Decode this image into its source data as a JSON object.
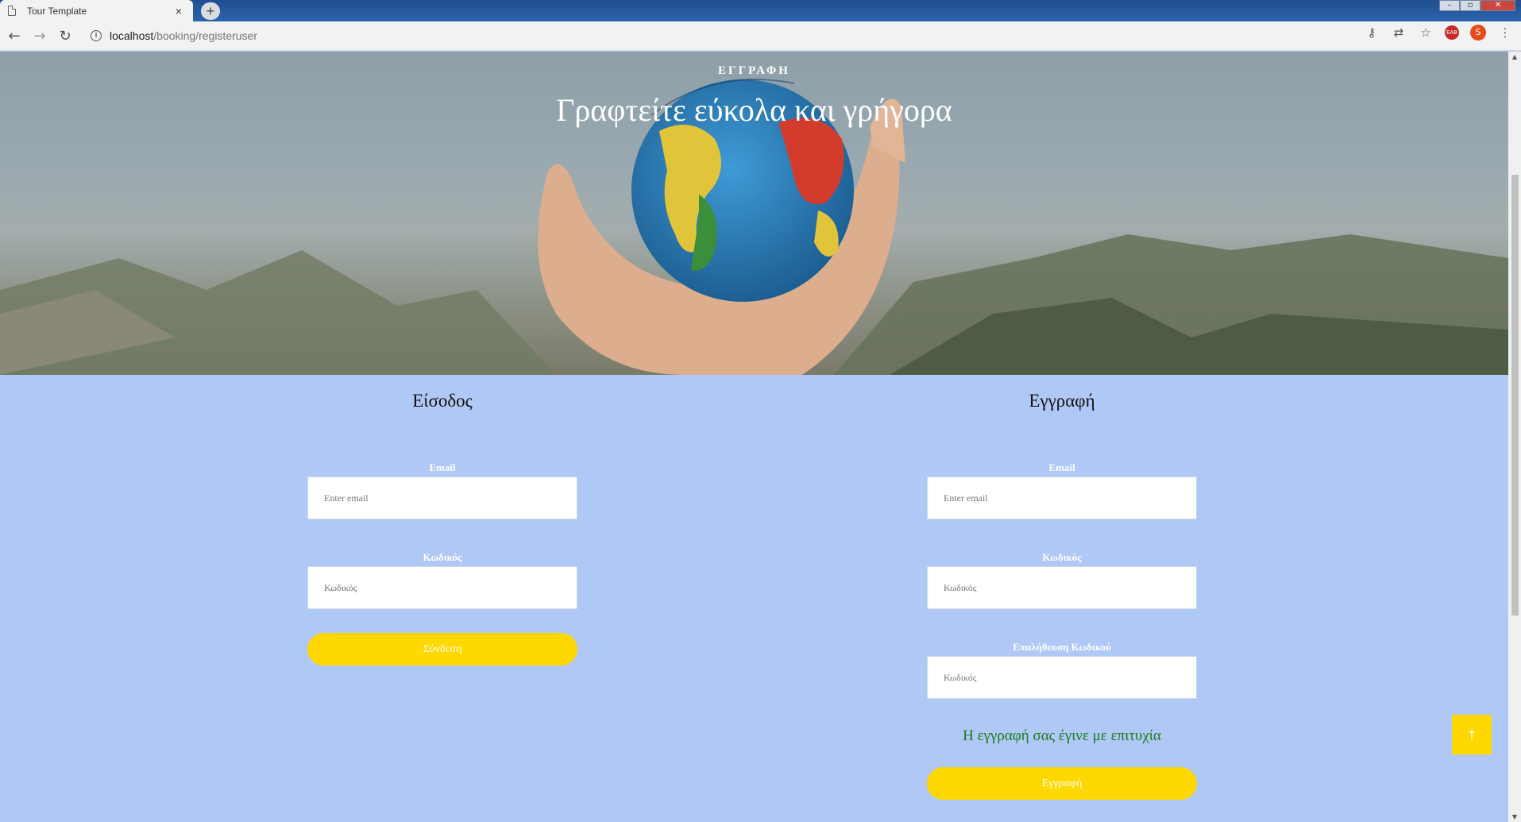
{
  "browser": {
    "tab_title": "Tour Template",
    "tab_close": "×",
    "new_tab": "+",
    "url_host": "localhost",
    "url_path": "/booking/registeruser",
    "back": "←",
    "forward": "→",
    "reload": "↻",
    "ext_label": "EAB",
    "avatar_label": "S",
    "menu": "⋮"
  },
  "hero": {
    "subtitle": "ΕΓΓΡΑΦΗ",
    "title": "Γραφτείτε εύκολα και γρήγορα"
  },
  "login": {
    "heading": "Είσοδος",
    "email_label": "Email",
    "email_placeholder": "Enter email",
    "password_label": "Κωδικός",
    "password_placeholder": "Κωδικός",
    "submit": "Σύνδεση"
  },
  "register": {
    "heading": "Εγγραφή",
    "email_label": "Email",
    "email_placeholder": "Enter email",
    "password_label": "Κωδικός",
    "password_placeholder": "Κωδικός",
    "confirm_label": "Επαλήθευση Κωδικού",
    "confirm_placeholder": "Κωδικός",
    "success_message": "Η εγγραφή σας έγινε με επιτυχία",
    "submit": "Εγγραφή"
  },
  "back_to_top": "↑",
  "colors": {
    "page_bg": "#b0c8f5",
    "button": "#ffd800",
    "success": "#1b7a1b"
  }
}
